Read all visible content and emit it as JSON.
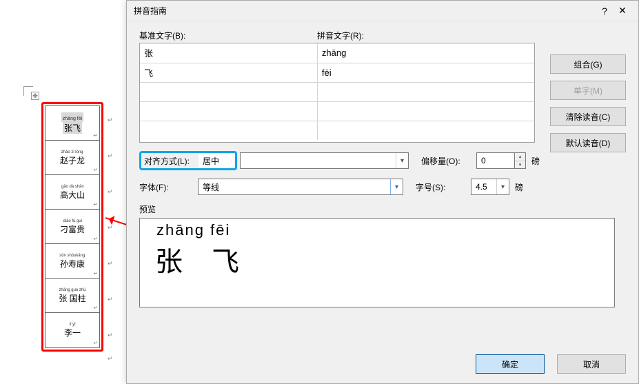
{
  "dialog": {
    "title": "拼音指南",
    "labels": {
      "base": "基准文字(B):",
      "ruby": "拼音文字(R):",
      "align": "对齐方式(L):",
      "offset": "偏移量(O):",
      "font": "字体(F):",
      "size": "字号(S):",
      "preview": "预览"
    },
    "rows": [
      {
        "base": "张",
        "ruby": "zhāng"
      },
      {
        "base": "飞",
        "ruby": "fēi"
      }
    ],
    "buttons": {
      "combine": "组合(G)",
      "single": "单字(M)",
      "clear": "清除读音(C)",
      "default": "默认读音(D)",
      "ok": "确定",
      "cancel": "取消"
    },
    "align_value": "居中",
    "offset_value": "0",
    "offset_unit": "磅",
    "font_value": "等线",
    "size_value": "4.5",
    "size_unit": "磅",
    "preview_pinyin": "zhāng  fēi",
    "preview_chars": "张 飞"
  },
  "sample_table": [
    {
      "pinyin": "zhāng fēi",
      "chars": "张飞",
      "highlight": true
    },
    {
      "pinyin": "zhào zǐ lóng",
      "chars": "赵子龙"
    },
    {
      "pinyin": "gāo dà shān",
      "chars": "高大山"
    },
    {
      "pinyin": "diāo fù guì",
      "chars": "刁富贵"
    },
    {
      "pinyin": "sūn shòukāng",
      "chars": "孙寿康"
    },
    {
      "pinyin": "zhāng guó zhù",
      "chars": "张 国柱"
    },
    {
      "pinyin": "lǐ yī",
      "chars": "李一"
    }
  ],
  "glyphs": {
    "help": "?",
    "close": "✕",
    "down": "▾",
    "up": "▴",
    "para": "↵",
    "move": "✥"
  }
}
